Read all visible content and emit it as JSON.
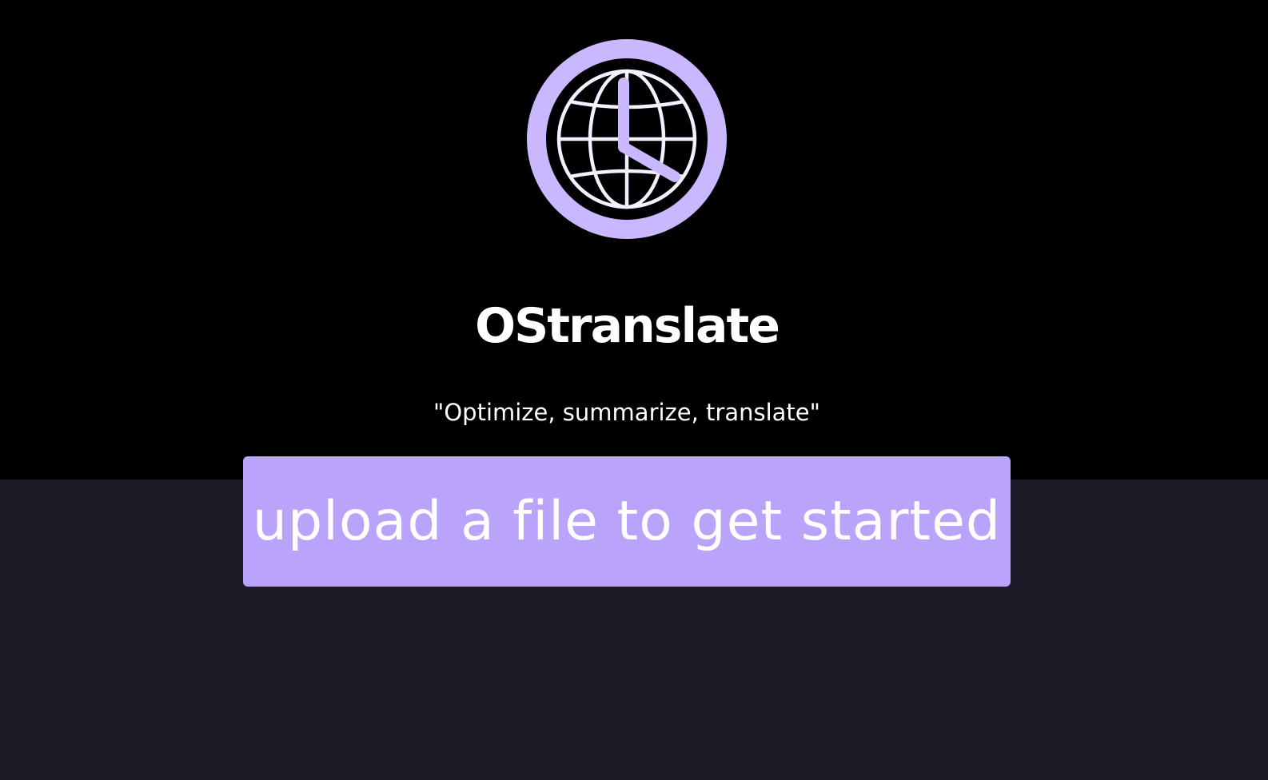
{
  "app": {
    "title": "OStranslate",
    "tagline": "\"Optimize, summarize, translate\"",
    "logo_icon": "globe-clock-icon"
  },
  "upload": {
    "label": "upload a file to get started"
  },
  "colors": {
    "accent": "#b9a3fb",
    "logo_ring": "#c9b8ff",
    "hero_background": "#000000",
    "page_background": "#1e1a28",
    "text": "#ffffff"
  }
}
